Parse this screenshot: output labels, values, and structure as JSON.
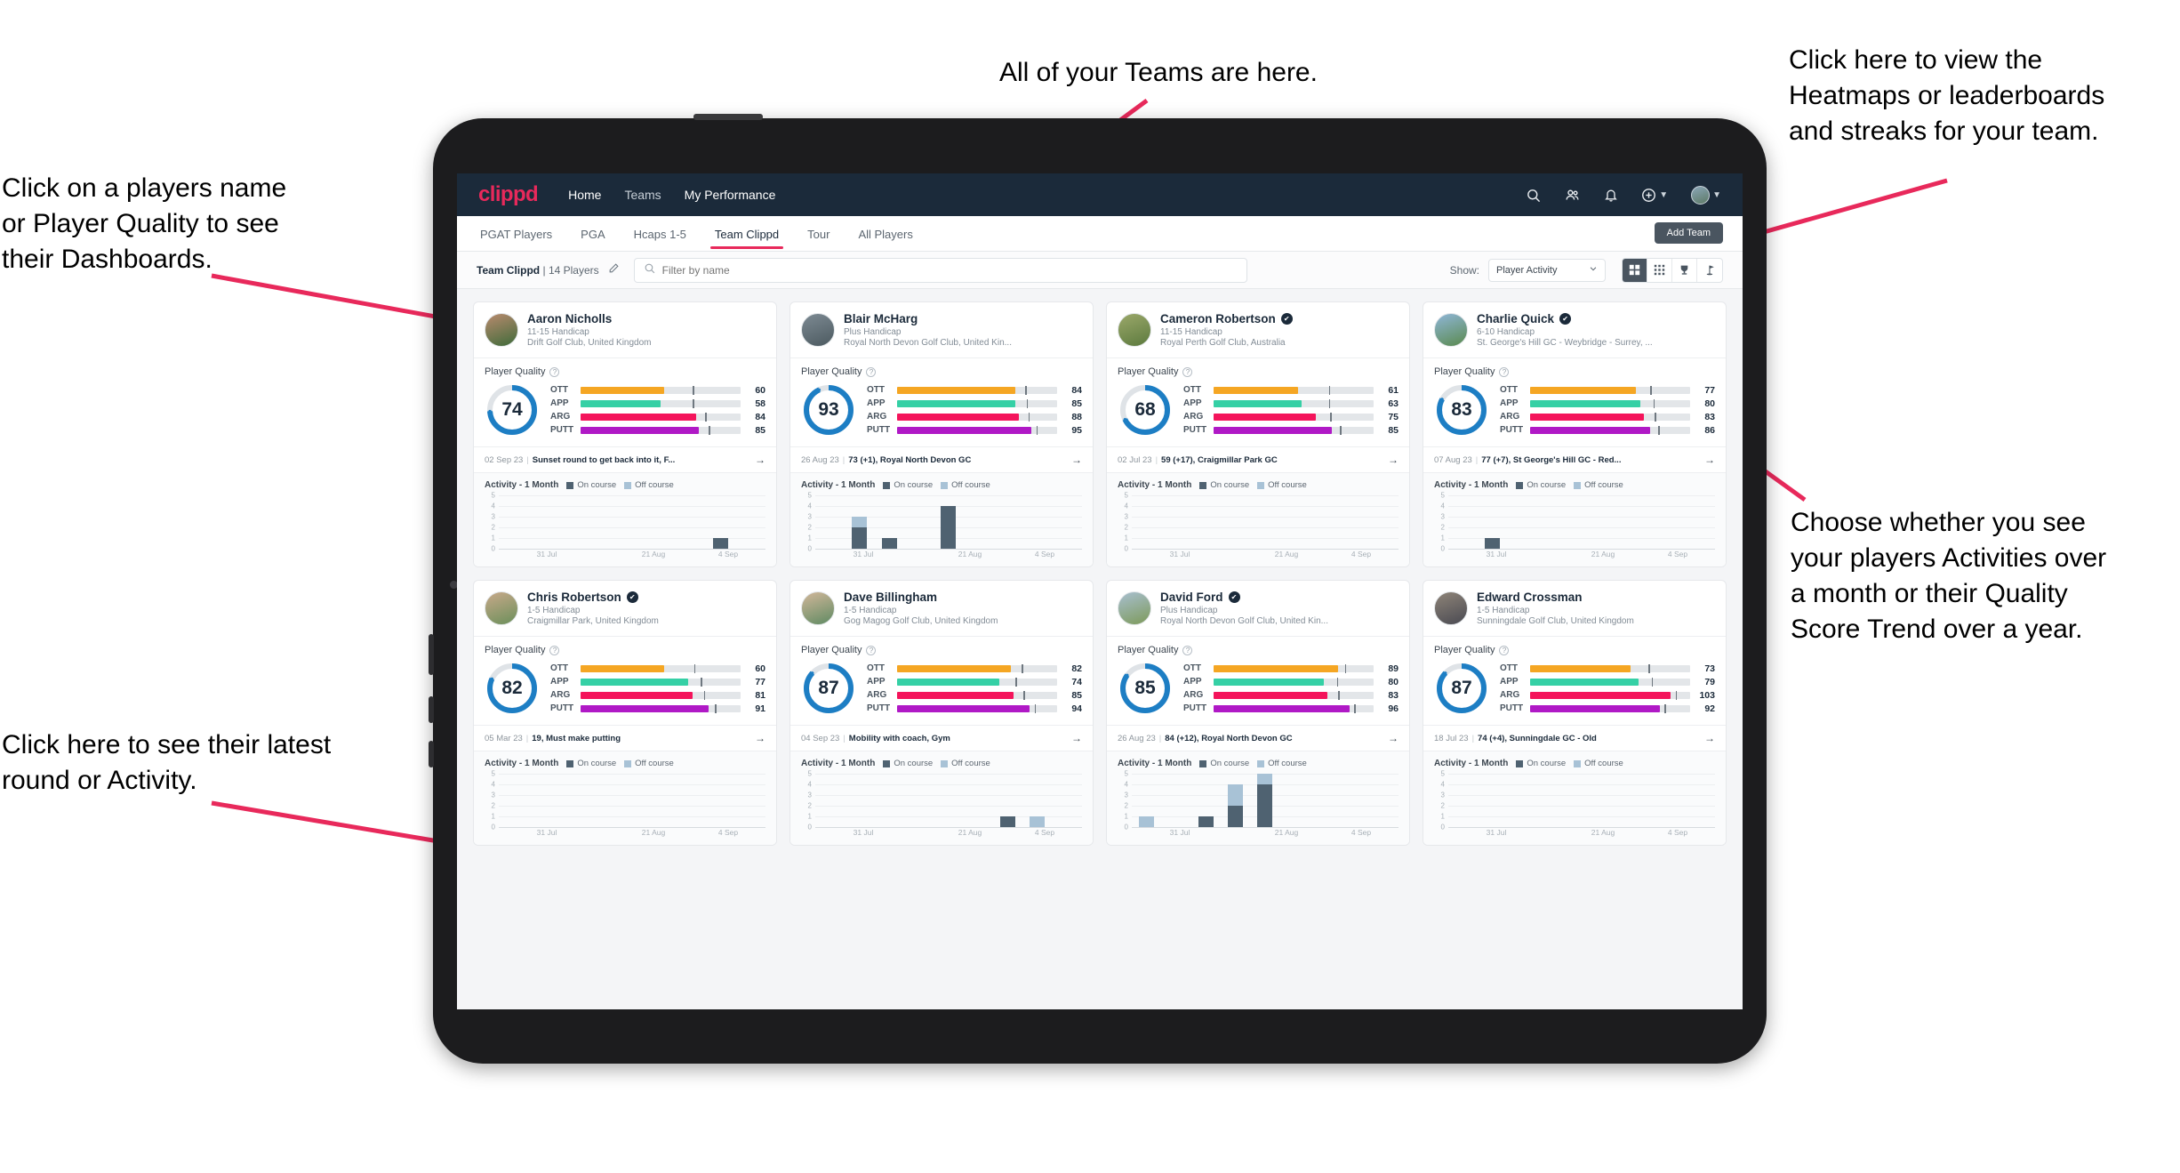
{
  "annotations": [
    {
      "id": "teams-note",
      "text": "All of your Teams are here."
    },
    {
      "id": "heatmaps-note",
      "text": "Click here to view the\nHeatmaps or leaderboards\nand streaks for your team."
    },
    {
      "id": "dashboards-note",
      "text": "Click on a players name\nor Player Quality to see\ntheir Dashboards."
    },
    {
      "id": "activity-note",
      "text": "Choose whether you see\nyour players Activities over\na month or their Quality\nScore Trend over a year."
    },
    {
      "id": "latest-round-note",
      "text": "Click here to see their latest\nround or Activity."
    }
  ],
  "topnav": {
    "logo": "clippd",
    "links": [
      {
        "label": "Home",
        "active": true
      },
      {
        "label": "Teams",
        "active": false
      },
      {
        "label": "My Performance",
        "active": true
      }
    ],
    "icons": [
      "search-icon",
      "people-icon",
      "bell-icon",
      "plus-circle-icon",
      "avatar"
    ]
  },
  "tabs": [
    {
      "label": "PGAT Players",
      "active": false
    },
    {
      "label": "PGA",
      "active": false
    },
    {
      "label": "Hcaps 1-5",
      "active": false
    },
    {
      "label": "Team Clippd",
      "active": true
    },
    {
      "label": "Tour",
      "active": false
    },
    {
      "label": "All Players",
      "active": false
    }
  ],
  "add_team_label": "Add Team",
  "filterbar": {
    "team_name": "Team Clippd",
    "team_count": "14 Players",
    "separator": "|",
    "search_placeholder": "Filter by name",
    "search_value": "",
    "show_label": "Show:",
    "show_value": "Player Activity",
    "view_buttons": [
      {
        "name": "grid-large-icon",
        "active": true
      },
      {
        "name": "grid-small-icon",
        "active": false
      },
      {
        "name": "trophy-icon",
        "active": false
      },
      {
        "name": "flag-icon",
        "active": false
      }
    ]
  },
  "card_labels": {
    "player_quality": "Player Quality",
    "activity": "Activity - 1 Month",
    "legend_on": "On course",
    "legend_off": "Off course"
  },
  "colors": {
    "accent": "#e8295b",
    "navy": "#1b2a3a",
    "ott": "#f5a623",
    "app": "#35d0a5",
    "arg": "#f4145b",
    "putt": "#b019c6",
    "ring": "#1d7ec4",
    "on_course": "#4f6271",
    "off_course": "#a8c2d6"
  },
  "chart_data": {
    "type": "bar",
    "title": "Activity - 1 Month",
    "xlabel": "",
    "ylabel": "",
    "ylim": [
      0,
      5
    ],
    "yticks": [
      0,
      1,
      2,
      3,
      4,
      5
    ],
    "xticks": [
      "31 Jul",
      "21 Aug",
      "4 Sep"
    ],
    "grid": true,
    "legend": [
      "On course",
      "Off course"
    ],
    "stacked": true
  },
  "players": [
    {
      "name": "Aaron Nicholls",
      "verified": false,
      "handicap": "11-15 Handicap",
      "club": "Drift Golf Club, United Kingdom",
      "quality_score": "74",
      "quality_pct": 74,
      "avatar_colors": [
        "#b98a6e",
        "#3f6b3a"
      ],
      "metrics": [
        {
          "label": "OTT",
          "value": "60",
          "fill": 52,
          "tick": 70
        },
        {
          "label": "APP",
          "value": "58",
          "fill": 50,
          "tick": 70
        },
        {
          "label": "ARG",
          "value": "84",
          "fill": 72,
          "tick": 78
        },
        {
          "label": "PUTT",
          "value": "85",
          "fill": 74,
          "tick": 80
        }
      ],
      "round_date": "02 Sep 23",
      "round_desc": "Sunset round to get back into it, F...",
      "activity": {
        "on": [
          0,
          0,
          0,
          0,
          0,
          0,
          0,
          1,
          0
        ],
        "off": [
          0,
          0,
          0,
          0,
          0,
          0,
          0,
          0,
          0
        ]
      }
    },
    {
      "name": "Blair McHarg",
      "verified": false,
      "handicap": "Plus Handicap",
      "club": "Royal North Devon Golf Club, United Kin...",
      "quality_score": "93",
      "quality_pct": 93,
      "avatar_colors": [
        "#7d8a93",
        "#4c5a60"
      ],
      "metrics": [
        {
          "label": "OTT",
          "value": "84",
          "fill": 74,
          "tick": 80
        },
        {
          "label": "APP",
          "value": "85",
          "fill": 74,
          "tick": 81
        },
        {
          "label": "ARG",
          "value": "88",
          "fill": 76,
          "tick": 82
        },
        {
          "label": "PUTT",
          "value": "95",
          "fill": 84,
          "tick": 87
        }
      ],
      "round_date": "26 Aug 23",
      "round_desc": "73 (+1), Royal North Devon GC",
      "activity": {
        "on": [
          0,
          2,
          1,
          0,
          4,
          0,
          0,
          0,
          0
        ],
        "off": [
          0,
          1,
          0,
          0,
          0,
          0,
          0,
          0,
          0
        ]
      }
    },
    {
      "name": "Cameron Robertson",
      "verified": true,
      "handicap": "11-15 Handicap",
      "club": "Royal Perth Golf Club, Australia",
      "quality_score": "68",
      "quality_pct": 68,
      "avatar_colors": [
        "#9ba86a",
        "#5c7a3e"
      ],
      "metrics": [
        {
          "label": "OTT",
          "value": "61",
          "fill": 53,
          "tick": 72
        },
        {
          "label": "APP",
          "value": "63",
          "fill": 55,
          "tick": 72
        },
        {
          "label": "ARG",
          "value": "75",
          "fill": 64,
          "tick": 73
        },
        {
          "label": "PUTT",
          "value": "85",
          "fill": 74,
          "tick": 79
        }
      ],
      "round_date": "02 Jul 23",
      "round_desc": "59 (+17), Craigmillar Park GC",
      "activity": {
        "on": [
          0,
          0,
          0,
          0,
          0,
          0,
          0,
          0,
          0
        ],
        "off": [
          0,
          0,
          0,
          0,
          0,
          0,
          0,
          0,
          0
        ]
      }
    },
    {
      "name": "Charlie Quick",
      "verified": true,
      "handicap": "6-10 Handicap",
      "club": "St. George's Hill GC - Weybridge - Surrey, ...",
      "quality_score": "83",
      "quality_pct": 83,
      "avatar_colors": [
        "#8fb6d8",
        "#5a8a4e"
      ],
      "metrics": [
        {
          "label": "OTT",
          "value": "77",
          "fill": 66,
          "tick": 75
        },
        {
          "label": "APP",
          "value": "80",
          "fill": 69,
          "tick": 77
        },
        {
          "label": "ARG",
          "value": "83",
          "fill": 71,
          "tick": 78
        },
        {
          "label": "PUTT",
          "value": "86",
          "fill": 75,
          "tick": 80
        }
      ],
      "round_date": "07 Aug 23",
      "round_desc": "77 (+7), St George's Hill GC - Red...",
      "activity": {
        "on": [
          0,
          1,
          0,
          0,
          0,
          0,
          0,
          0,
          0
        ],
        "off": [
          0,
          0,
          0,
          0,
          0,
          0,
          0,
          0,
          0
        ]
      }
    },
    {
      "name": "Chris Robertson",
      "verified": true,
      "handicap": "1-5 Handicap",
      "club": "Craigmillar Park, United Kingdom",
      "quality_score": "82",
      "quality_pct": 82,
      "avatar_colors": [
        "#c8a98a",
        "#6b8f5a"
      ],
      "metrics": [
        {
          "label": "OTT",
          "value": "60",
          "fill": 52,
          "tick": 71
        },
        {
          "label": "APP",
          "value": "77",
          "fill": 67,
          "tick": 75
        },
        {
          "label": "ARG",
          "value": "81",
          "fill": 70,
          "tick": 77
        },
        {
          "label": "PUTT",
          "value": "91",
          "fill": 80,
          "tick": 84
        }
      ],
      "round_date": "05 Mar 23",
      "round_desc": "19, Must make putting",
      "activity": {
        "on": [
          0,
          0,
          0,
          0,
          0,
          0,
          0,
          0,
          0
        ],
        "off": [
          0,
          0,
          0,
          0,
          0,
          0,
          0,
          0,
          0
        ]
      }
    },
    {
      "name": "Dave Billingham",
      "verified": false,
      "handicap": "1-5 Handicap",
      "club": "Gog Magog Golf Club, United Kingdom",
      "quality_score": "87",
      "quality_pct": 87,
      "avatar_colors": [
        "#d2b79a",
        "#5f8a62"
      ],
      "metrics": [
        {
          "label": "OTT",
          "value": "82",
          "fill": 71,
          "tick": 78
        },
        {
          "label": "APP",
          "value": "74",
          "fill": 64,
          "tick": 74
        },
        {
          "label": "ARG",
          "value": "85",
          "fill": 73,
          "tick": 79
        },
        {
          "label": "PUTT",
          "value": "94",
          "fill": 83,
          "tick": 86
        }
      ],
      "round_date": "04 Sep 23",
      "round_desc": "Mobility with coach, Gym",
      "activity": {
        "on": [
          0,
          0,
          0,
          0,
          0,
          0,
          1,
          0,
          0
        ],
        "off": [
          0,
          0,
          0,
          0,
          0,
          0,
          0,
          1,
          0
        ]
      }
    },
    {
      "name": "David Ford",
      "verified": true,
      "handicap": "Plus Handicap",
      "club": "Royal North Devon Golf Club, United Kin...",
      "quality_score": "85",
      "quality_pct": 85,
      "avatar_colors": [
        "#a8bfd0",
        "#7d9a5a"
      ],
      "metrics": [
        {
          "label": "OTT",
          "value": "89",
          "fill": 78,
          "tick": 82
        },
        {
          "label": "APP",
          "value": "80",
          "fill": 69,
          "tick": 77
        },
        {
          "label": "ARG",
          "value": "83",
          "fill": 71,
          "tick": 78
        },
        {
          "label": "PUTT",
          "value": "96",
          "fill": 85,
          "tick": 88
        }
      ],
      "round_date": "26 Aug 23",
      "round_desc": "84 (+12), Royal North Devon GC",
      "activity": {
        "on": [
          0,
          0,
          1,
          2,
          4,
          0,
          0,
          0,
          0
        ],
        "off": [
          1,
          0,
          0,
          2,
          1,
          0,
          0,
          0,
          0
        ]
      }
    },
    {
      "name": "Edward Crossman",
      "verified": false,
      "handicap": "1-5 Handicap",
      "club": "Sunningdale Golf Club, United Kingdom",
      "quality_score": "87",
      "quality_pct": 87,
      "avatar_colors": [
        "#8e8478",
        "#4a4a52"
      ],
      "metrics": [
        {
          "label": "OTT",
          "value": "73",
          "fill": 63,
          "tick": 74
        },
        {
          "label": "APP",
          "value": "79",
          "fill": 68,
          "tick": 76
        },
        {
          "label": "ARG",
          "value": "103",
          "fill": 88,
          "tick": 91
        },
        {
          "label": "PUTT",
          "value": "92",
          "fill": 81,
          "tick": 84
        }
      ],
      "round_date": "18 Jul 23",
      "round_desc": "74 (+4), Sunningdale GC - Old",
      "activity": {
        "on": [
          0,
          0,
          0,
          0,
          0,
          0,
          0,
          0,
          0
        ],
        "off": [
          0,
          0,
          0,
          0,
          0,
          0,
          0,
          0,
          0
        ]
      }
    }
  ]
}
